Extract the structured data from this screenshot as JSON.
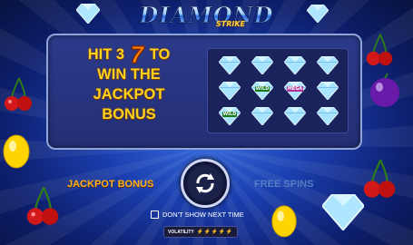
{
  "logo": {
    "main": "DIAMOND",
    "sub": "STRIKE"
  },
  "panel": {
    "line1_before": "HIT 3",
    "seven": "7",
    "line1_after": "TO",
    "line2": "WIN THE",
    "line3": "JACKPOT",
    "line4": "BONUS"
  },
  "grid": {
    "cells": [
      "diamond",
      "diamond",
      "diamond",
      "diamond",
      "diamond",
      "wild-diamond",
      "mega-diamond",
      "diamond",
      "wild-diamond",
      "diamond",
      "diamond",
      "diamond"
    ],
    "wild_labels": {
      "wild": "WILD",
      "mega": "MEGA"
    }
  },
  "bottom": {
    "jackpot_label": "JACKPOT BONUS",
    "freespins_label": "FREE SPINS",
    "spin_icon": "refresh-icon"
  },
  "dont_show": "DON'T SHOW NEXT TIME",
  "volatility": {
    "label": "VOLATILITY",
    "value": "⚡⚡⚡⚡⚡"
  },
  "colors": {
    "accent": "#ffd21c",
    "panel": "#2b3a8a",
    "background": "#1b3fb0"
  }
}
